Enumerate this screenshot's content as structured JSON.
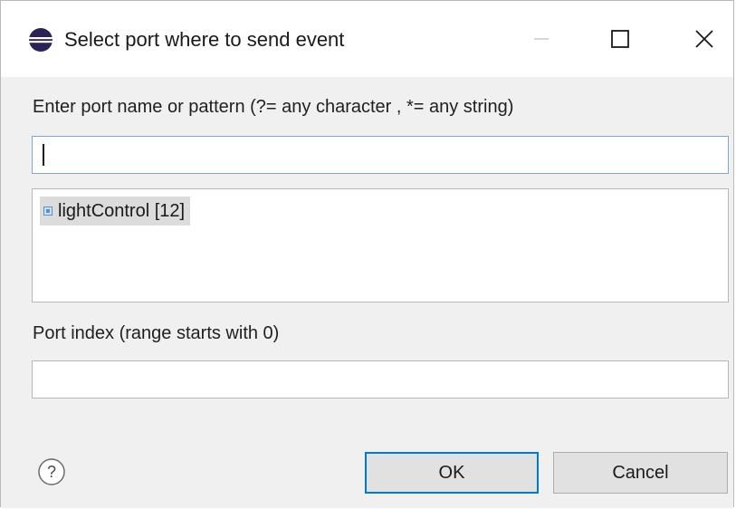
{
  "window": {
    "title": "Select port where to send event",
    "icon": "eclipse-icon"
  },
  "titlebar_buttons": {
    "minimize": "minimize-icon",
    "maximize": "maximize-icon",
    "close": "close-icon"
  },
  "form": {
    "pattern_label": "Enter port name or pattern (?= any character , *= any string)",
    "pattern_value": "",
    "ports": [
      {
        "label": "lightControl [12]",
        "icon": "port-icon",
        "selected": true
      }
    ],
    "index_label": "Port index (range starts with 0)",
    "index_value": ""
  },
  "buttons": {
    "help": "help-icon",
    "ok": "OK",
    "cancel": "Cancel"
  },
  "colors": {
    "focus_border": "#0078d7",
    "selection_bg": "#dcdcdc",
    "dialog_bg": "#f0f0f0"
  }
}
